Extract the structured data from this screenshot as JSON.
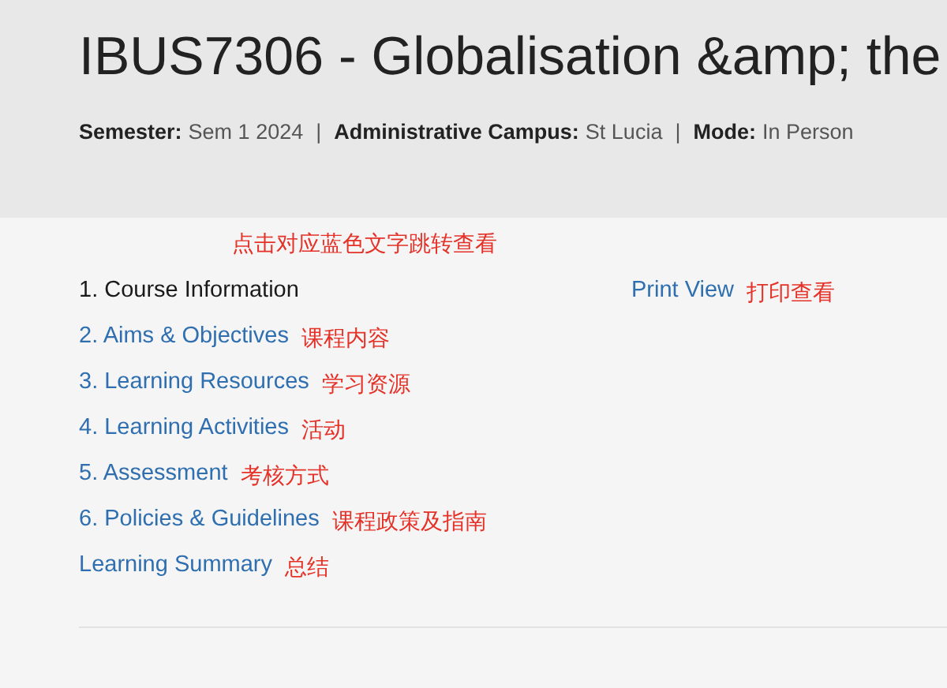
{
  "header": {
    "title": "IBUS7306 - Globalisation &amp; the",
    "separator": "|",
    "meta": [
      {
        "label": "Semester:",
        "value": "Sem 1 2024"
      },
      {
        "label": "Administrative Campus:",
        "value": "St Lucia"
      },
      {
        "label": "Mode:",
        "value": "In Person"
      }
    ]
  },
  "top_note": "点击对应蓝色文字跳转查看",
  "nav": {
    "items": [
      {
        "label": "1. Course Information",
        "selected": true
      },
      {
        "label": "2. Aims & Objectives",
        "selected": false,
        "note": "课程内容"
      },
      {
        "label": "3. Learning Resources",
        "selected": false,
        "note": "学习资源"
      },
      {
        "label": "4. Learning Activities",
        "selected": false,
        "note": "活动"
      },
      {
        "label": "5. Assessment",
        "selected": false,
        "note": "考核方式"
      },
      {
        "label": "6. Policies & Guidelines",
        "selected": false,
        "note": "课程政策及指南"
      },
      {
        "label": "Learning Summary",
        "selected": false,
        "note": "总结"
      }
    ]
  },
  "print_view": {
    "label": "Print View",
    "note": "打印查看"
  }
}
